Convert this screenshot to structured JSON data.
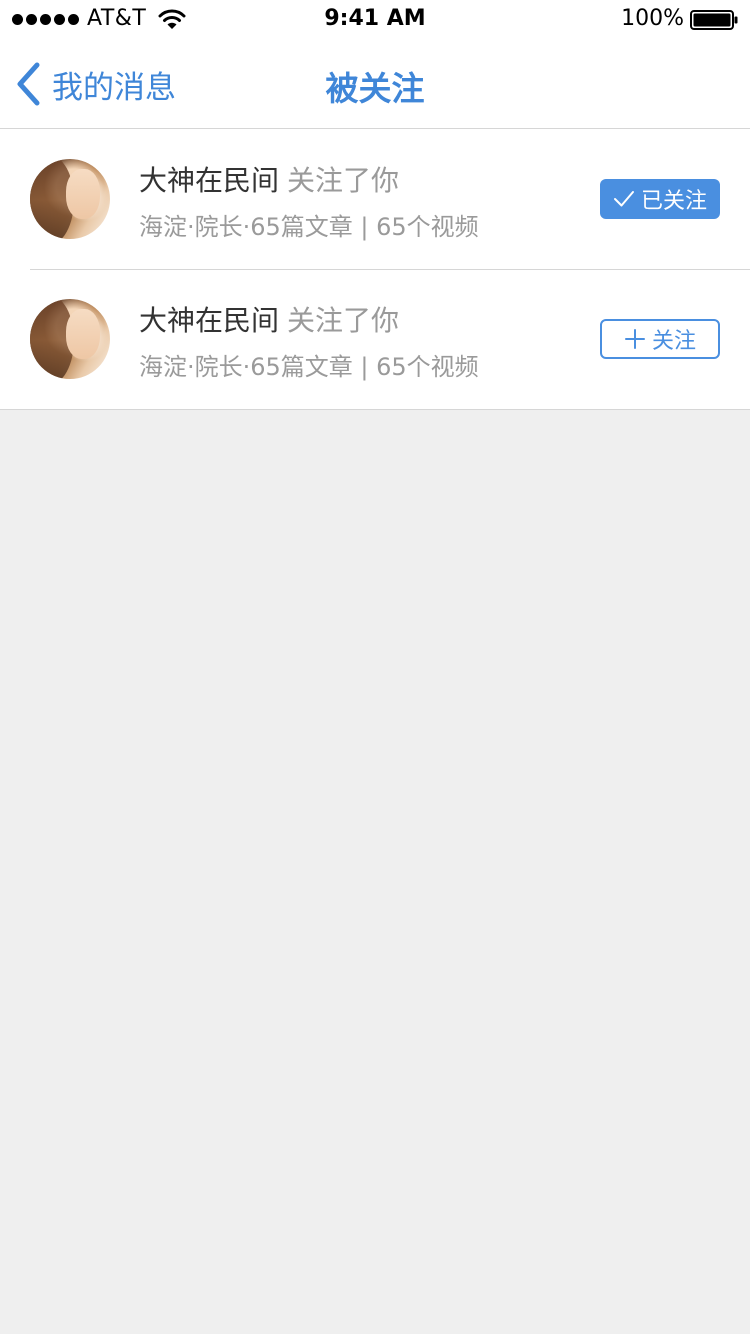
{
  "status_bar": {
    "carrier": "AT&T",
    "time": "9:41 AM",
    "battery_percent": "100%",
    "signal_bars": 5
  },
  "nav": {
    "back_label": "我的消息",
    "title": "被关注",
    "accent_color": "#3f86d8"
  },
  "items": [
    {
      "name": "大神在民间",
      "action": "关注了你",
      "meta": "海淀·院长·65篇文章 | 65个视频",
      "button_label": "已关注",
      "button_icon": "check-icon",
      "followed": true
    },
    {
      "name": "大神在民间",
      "action": "关注了你",
      "meta": "海淀·院长·65篇文章 | 65个视频",
      "button_label": "关注",
      "button_icon": "plus-icon",
      "followed": false
    }
  ]
}
